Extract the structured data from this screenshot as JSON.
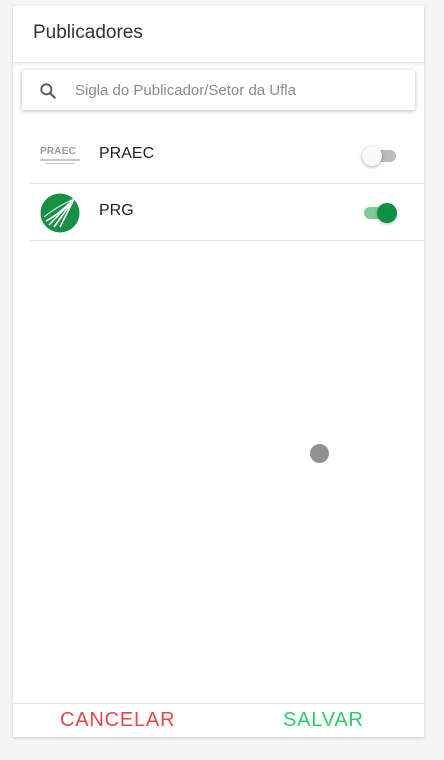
{
  "dialog": {
    "title": "Publicadores"
  },
  "search": {
    "placeholder": "Sigla do Publicador/Setor da Ufla",
    "value": "",
    "icon": "search-icon"
  },
  "publishers": [
    {
      "name": "PRAEC",
      "logo_text": "PRAEC",
      "enabled": false
    },
    {
      "name": "PRG",
      "logo": "prg-logo",
      "enabled": true
    }
  ],
  "footer": {
    "cancel_label": "CANCELAR",
    "save_label": "SALVAR"
  },
  "colors": {
    "cancel": "#e04848",
    "save": "#2ecc71",
    "toggle_on": "#0f9145",
    "toggle_on_track": "#7ccc9b",
    "toggle_off_track": "#bdbdbd"
  }
}
